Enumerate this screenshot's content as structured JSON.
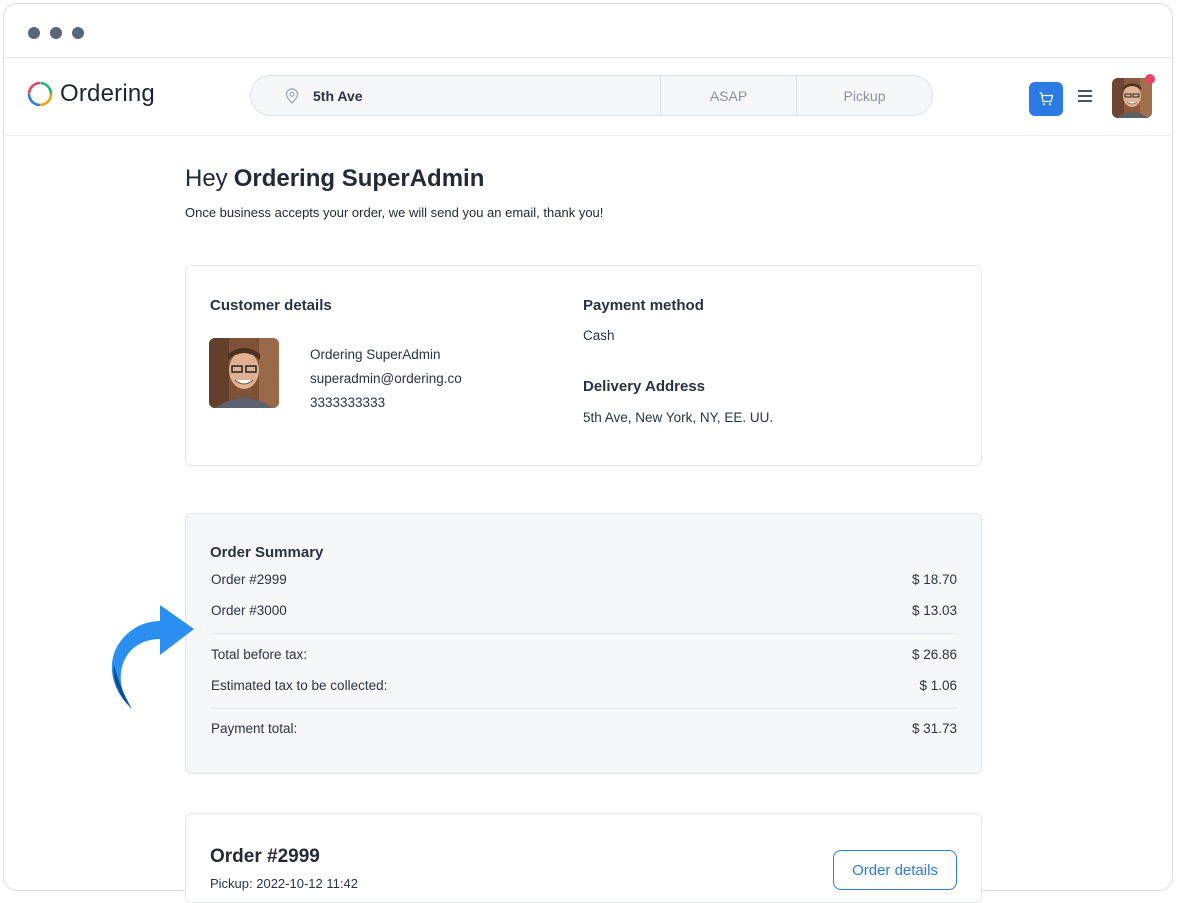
{
  "brand": {
    "name": "Ordering"
  },
  "search": {
    "address": "5th Ave",
    "time": "ASAP",
    "order_type": "Pickup"
  },
  "greeting": {
    "hey": "Hey",
    "name": "Ordering SuperAdmin",
    "message": "Once business accepts your order, we will send you an email, thank you!"
  },
  "customer": {
    "title": "Customer details",
    "name": "Ordering SuperAdmin",
    "email": "superadmin@ordering.co",
    "phone": "3333333333"
  },
  "payment": {
    "title": "Payment method",
    "method": "Cash"
  },
  "delivery": {
    "title": "Delivery Address",
    "address": "5th Ave, New York, NY, EE. UU."
  },
  "summary": {
    "title": "Order Summary",
    "orders": [
      {
        "label": "Order #2999",
        "amount": "$ 18.70"
      },
      {
        "label": "Order #3000",
        "amount": "$ 13.03"
      }
    ],
    "subtotal_label": "Total before tax:",
    "subtotal": "$ 26.86",
    "tax_label": "Estimated tax to be collected:",
    "tax": "$ 1.06",
    "total_label": "Payment total:",
    "total": "$ 31.73"
  },
  "order_card": {
    "title": "Order #2999",
    "pickup": "Pickup: 2022-10-12 11:42",
    "details_button": "Order details"
  },
  "colors": {
    "accent": "#2c7be5",
    "notification": "#ea4264"
  }
}
